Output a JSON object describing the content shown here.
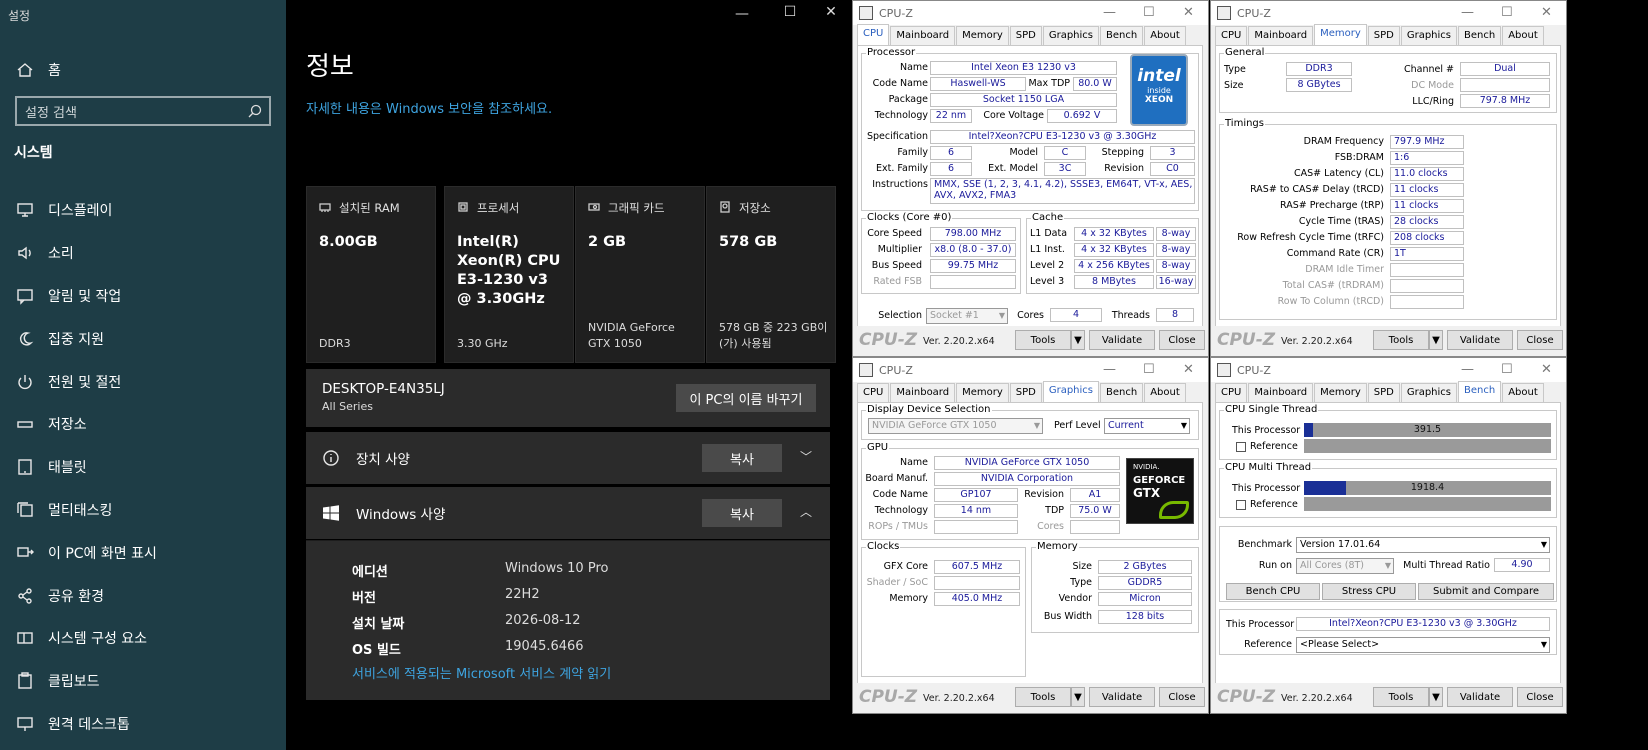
{
  "settings": {
    "window_title": "설정",
    "nav": {
      "home": "홈",
      "search_placeholder": "설정 검색",
      "section": "시스템",
      "items": [
        {
          "label": "디스플레이",
          "icon": "monitor-icon"
        },
        {
          "label": "소리",
          "icon": "speaker-icon"
        },
        {
          "label": "알림 및 작업",
          "icon": "message-icon"
        },
        {
          "label": "집중 지원",
          "icon": "moon-icon"
        },
        {
          "label": "전원 및 절전",
          "icon": "power-icon"
        },
        {
          "label": "저장소",
          "icon": "storage-icon"
        },
        {
          "label": "태블릿",
          "icon": "tablet-icon"
        },
        {
          "label": "멀티태스킹",
          "icon": "multitask-icon"
        },
        {
          "label": "이 PC에 화면 표시",
          "icon": "project-icon"
        },
        {
          "label": "공유 환경",
          "icon": "share-icon"
        },
        {
          "label": "시스템 구성 요소",
          "icon": "components-icon"
        },
        {
          "label": "클립보드",
          "icon": "clipboard-icon"
        },
        {
          "label": "원격 데스크톱",
          "icon": "remote-icon"
        }
      ]
    },
    "main": {
      "title": "정보",
      "security_link": "자세한 내용은 Windows 보안을 참조하세요.",
      "cards": [
        {
          "header": "설치된 RAM",
          "value": "8.00GB",
          "sub": "DDR3",
          "icon": "ram-icon"
        },
        {
          "header": "프로세서",
          "value": "Intel(R) Xeon(R) CPU E3-1230 v3 @ 3.30GHz",
          "sub": "3.30 GHz",
          "icon": "cpu-icon"
        },
        {
          "header": "그래픽 카드",
          "value": "2 GB",
          "sub": "NVIDIA GeForce GTX 1050",
          "icon": "gpu-icon"
        },
        {
          "header": "저장소",
          "value": "578 GB",
          "sub": "578 GB 중 223 GB이(가) 사용됨",
          "icon": "storage-icon"
        }
      ],
      "pc_name": "DESKTOP-E4N35LJ",
      "pc_series": "All Series",
      "rename_button": "이 PC의 이름 바꾸기",
      "device_specs": {
        "label": "장치 사양",
        "copy": "복사"
      },
      "windows_specs": {
        "label": "Windows 사양",
        "copy": "복사",
        "rows": [
          {
            "key": "에디션",
            "value": "Windows 10 Pro"
          },
          {
            "key": "버전",
            "value": "22H2"
          },
          {
            "key": "설치 날짜",
            "value": "2026-08-12"
          },
          {
            "key": "OS 빌드",
            "value": "19045.6466"
          }
        ],
        "ms_link": "서비스에 적용되는 Microsoft 서비스 계약 읽기"
      }
    }
  },
  "cpuz": {
    "title": "CPU-Z",
    "tabs": [
      "CPU",
      "Mainboard",
      "Memory",
      "SPD",
      "Graphics",
      "Bench",
      "About"
    ],
    "footer": {
      "brand": "CPU-Z",
      "version": "Ver. 2.20.2.x64",
      "tools": "Tools",
      "validate": "Validate",
      "close": "Close"
    },
    "cpu": {
      "processor_group": "Processor",
      "name_label": "Name",
      "name": "Intel Xeon E3 1230 v3",
      "codename_label": "Code Name",
      "codename": "Haswell-WS",
      "maxtdp_label": "Max TDP",
      "maxtdp": "80.0 W",
      "package_label": "Package",
      "package": "Socket 1150 LGA",
      "technology_label": "Technology",
      "technology": "22 nm",
      "corevolt_label": "Core Voltage",
      "corevolt": "0.692 V",
      "spec_label": "Specification",
      "spec": "Intel?Xeon?CPU E3-1230 v3 @ 3.30GHz",
      "family_label": "Family",
      "family": "6",
      "model_label": "Model",
      "model": "C",
      "stepping_label": "Stepping",
      "stepping": "3",
      "extfamily_label": "Ext. Family",
      "extfamily": "6",
      "extmodel_label": "Ext. Model",
      "extmodel": "3C",
      "revision_label": "Revision",
      "revision": "C0",
      "instr_label": "Instructions",
      "instr": "MMX, SSE (1, 2, 3, 4.1, 4.2), SSSE3, EM64T, VT-x, AES, AVX, AVX2, FMA3",
      "logo": {
        "brand": "intel",
        "sub": "inside",
        "line": "XEON"
      },
      "clocks_group": "Clocks (Core #0)",
      "corespeed_label": "Core Speed",
      "corespeed": "798.00 MHz",
      "multiplier_label": "Multiplier",
      "multiplier": "x8.0 (8.0 - 37.0)",
      "busspeed_label": "Bus Speed",
      "busspeed": "99.75 MHz",
      "ratedfsb_label": "Rated FSB",
      "cache_group": "Cache",
      "l1d_label": "L1 Data",
      "l1d": "4 x 32 KBytes",
      "l1d_way": "8-way",
      "l1i_label": "L1 Inst.",
      "l1i": "4 x 32 KBytes",
      "l1i_way": "8-way",
      "l2_label": "Level 2",
      "l2": "4 x 256 KBytes",
      "l2_way": "8-way",
      "l3_label": "Level 3",
      "l3": "8 MBytes",
      "l3_way": "16-way",
      "selection_label": "Selection",
      "selection": "Socket #1",
      "cores_label": "Cores",
      "cores": "4",
      "threads_label": "Threads",
      "threads": "8"
    },
    "memory": {
      "general_group": "General",
      "type_label": "Type",
      "type": "DDR3",
      "size_label": "Size",
      "size": "8 GBytes",
      "channel_label": "Channel #",
      "channel": "Dual",
      "dcmode_label": "DC Mode",
      "llc_label": "LLC/Ring",
      "llc": "797.8 MHz",
      "timings_group": "Timings",
      "rows": [
        {
          "label": "DRAM Frequency",
          "value": "797.9 MHz",
          "dis": false
        },
        {
          "label": "FSB:DRAM",
          "value": "1:6",
          "dis": false
        },
        {
          "label": "CAS# Latency (CL)",
          "value": "11.0 clocks",
          "dis": false
        },
        {
          "label": "RAS# to CAS# Delay (tRCD)",
          "value": "11 clocks",
          "dis": false
        },
        {
          "label": "RAS# Precharge (tRP)",
          "value": "11 clocks",
          "dis": false
        },
        {
          "label": "Cycle Time (tRAS)",
          "value": "28 clocks",
          "dis": false
        },
        {
          "label": "Row Refresh Cycle Time (tRFC)",
          "value": "208 clocks",
          "dis": false
        },
        {
          "label": "Command Rate (CR)",
          "value": "1T",
          "dis": false
        },
        {
          "label": "DRAM Idle Timer",
          "value": "",
          "dis": true
        },
        {
          "label": "Total CAS# (tRDRAM)",
          "value": "",
          "dis": true
        },
        {
          "label": "Row To Column (tRCD)",
          "value": "",
          "dis": true
        }
      ]
    },
    "graphics": {
      "display_group": "Display Device Selection",
      "device": "NVIDIA GeForce GTX 1050",
      "perf_label": "Perf Level",
      "perf": "Current",
      "gpu_group": "GPU",
      "name_label": "Name",
      "name": "NVIDIA GeForce GTX 1050",
      "board_label": "Board Manuf.",
      "board": "NVIDIA Corporation",
      "codename_label": "Code Name",
      "codename": "GP107",
      "revision_label": "Revision",
      "revision": "A1",
      "tech_label": "Technology",
      "tech": "14 nm",
      "tdp_label": "TDP",
      "tdp": "75.0 W",
      "rops_label": "ROPs / TMUs",
      "cores_label": "Cores",
      "logo": {
        "brand": "NVIDIA.",
        "line1": "GEFORCE",
        "line2": "GTX"
      },
      "clocks_group": "Clocks",
      "gfxcore_label": "GFX Core",
      "gfxcore": "607.5 MHz",
      "shader_label": "Shader / SoC",
      "memclock_label": "Memory",
      "memclock": "405.0 MHz",
      "memory_group": "Memory",
      "msize_label": "Size",
      "msize": "2 GBytes",
      "mtype_label": "Type",
      "mtype": "GDDR5",
      "vendor_label": "Vendor",
      "vendor": "Micron",
      "bus_label": "Bus Width",
      "bus": "128 bits"
    },
    "bench": {
      "single_group": "CPU Single Thread",
      "multi_group": "CPU Multi Thread",
      "this_label": "This Processor",
      "ref_label": "Reference",
      "single_score": "391.5",
      "single_fraction": 0.035,
      "multi_score": "1918.4",
      "multi_fraction": 0.17,
      "benchmark_label": "Benchmark",
      "benchmark": "Version 17.01.64",
      "runon_label": "Run on",
      "runon": "All Cores (8T)",
      "mtr_label": "Multi Thread Ratio",
      "mtr": "4.90",
      "bench_btn": "Bench CPU",
      "stress_btn": "Stress CPU",
      "submit_btn": "Submit and Compare",
      "this_proc_label": "This Processor",
      "this_proc": "Intel?Xeon?CPU E3-1230 v3 @ 3.30GHz",
      "reference_label": "Reference",
      "reference": "<Please Select>"
    }
  }
}
